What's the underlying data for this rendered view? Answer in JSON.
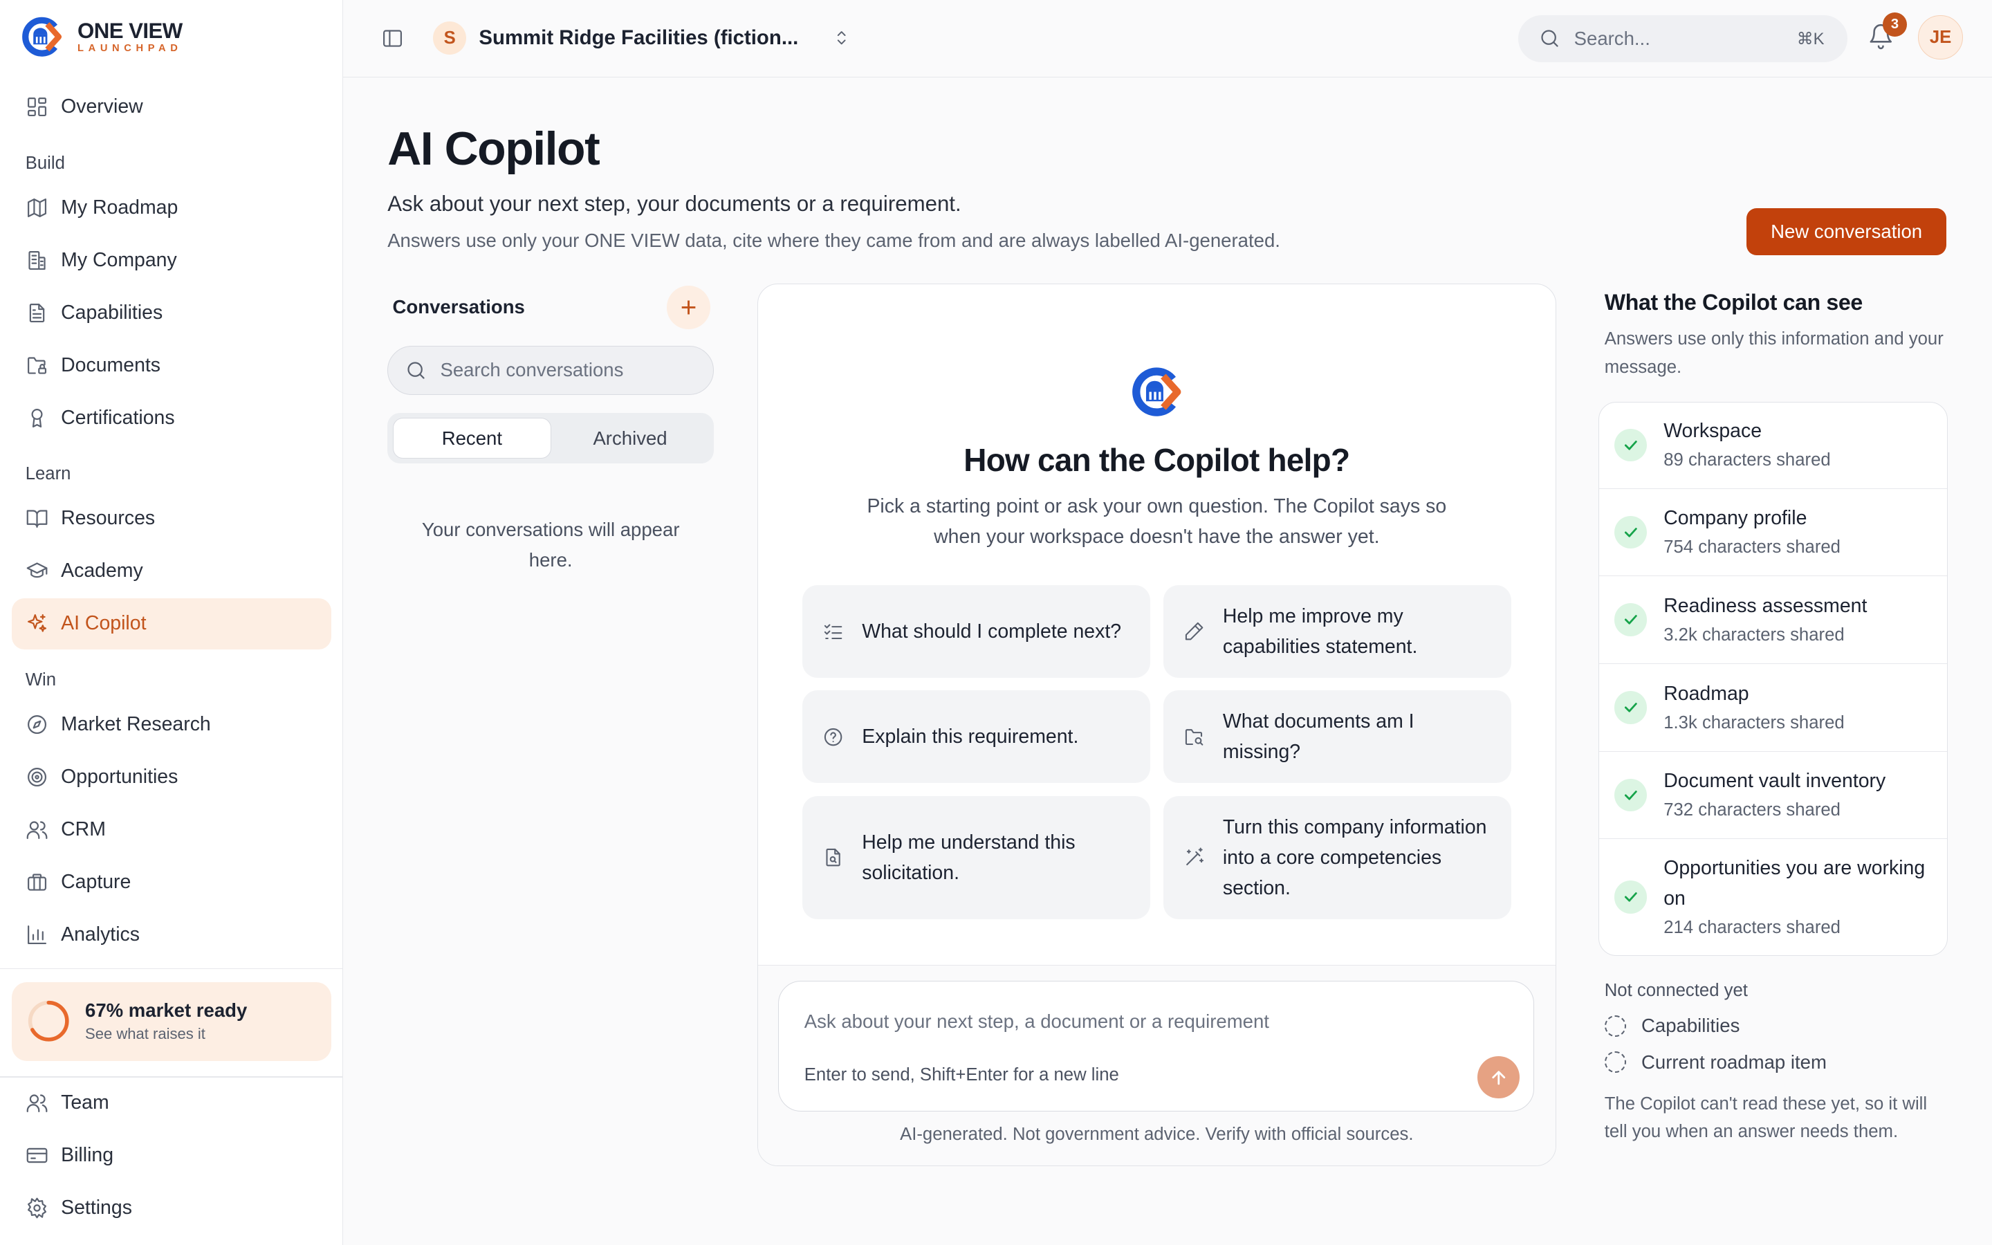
{
  "brand": {
    "name": "ONE VIEW",
    "tagline": "LAUNCHPAD"
  },
  "sidebar": {
    "overview": "Overview",
    "sections": {
      "build": "Build",
      "learn": "Learn",
      "win": "Win"
    },
    "build_items": [
      "My Roadmap",
      "My Company",
      "Capabilities",
      "Documents",
      "Certifications"
    ],
    "learn_items": [
      "Resources",
      "Academy",
      "AI Copilot"
    ],
    "win_items": [
      "Market Research",
      "Opportunities",
      "CRM",
      "Capture",
      "Analytics"
    ],
    "readiness": {
      "title": "67% market ready",
      "subtitle": "See what raises it",
      "progress": 0.67
    },
    "bottom_items": [
      "Team",
      "Billing",
      "Settings"
    ]
  },
  "topbar": {
    "org_initial": "S",
    "org_name": "Summit Ridge Facilities (fiction...",
    "search_placeholder": "Search...",
    "search_shortcut": "⌘K",
    "notification_count": "3",
    "user_initials": "JE"
  },
  "page": {
    "title": "AI Copilot",
    "subtitle": "Ask about your next step, your documents or a requirement.",
    "note": "Answers use only your ONE VIEW data, cite where they came from and are always labelled AI-generated.",
    "new_conversation": "New conversation"
  },
  "conversations": {
    "label": "Conversations",
    "add": "+",
    "search_placeholder": "Search conversations",
    "tabs": [
      "Recent",
      "Archived"
    ],
    "empty": "Your conversations will appear here."
  },
  "chat": {
    "heading": "How can the Copilot help?",
    "description": "Pick a starting point or ask your own question. The Copilot says so when your workspace doesn't have the answer yet.",
    "prompts": [
      "What should I complete next?",
      "Help me improve my capabilities statement.",
      "Explain this requirement.",
      "What documents am I missing?",
      "Help me understand this solicitation.",
      "Turn this company information into a core competencies section."
    ],
    "input_placeholder": "Ask about your next step, a document or a requirement",
    "input_hint": "Enter to send, Shift+Enter for a new line",
    "disclaimer": "AI-generated. Not government advice. Verify with official sources."
  },
  "context_panel": {
    "title": "What the Copilot can see",
    "description": "Answers use only this information and your message.",
    "sources": [
      {
        "name": "Workspace",
        "detail": "89 characters shared"
      },
      {
        "name": "Company profile",
        "detail": "754 characters shared"
      },
      {
        "name": "Readiness assessment",
        "detail": "3.2k characters shared"
      },
      {
        "name": "Roadmap",
        "detail": "1.3k characters shared"
      },
      {
        "name": "Document vault inventory",
        "detail": "732 characters shared"
      },
      {
        "name": "Opportunities you are working on",
        "detail": "214 characters shared"
      }
    ],
    "not_connected_title": "Not connected yet",
    "not_connected": [
      "Capabilities",
      "Current roadmap item"
    ],
    "not_connected_note": "The Copilot can't read these yet, so it will tell you when an answer needs them."
  },
  "colors": {
    "accent": "#c2410c",
    "accent_soft": "#fdeee3",
    "success": "#16a34a"
  }
}
